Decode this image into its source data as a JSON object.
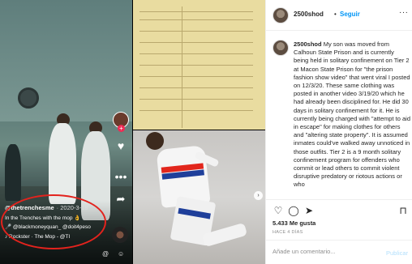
{
  "tiktok_overlay": {
    "username": "@thetrenchesme",
    "date": "· 2020-3-18",
    "line1": "In the Trenches with the mop 👌",
    "line2": "🎤 @blackmoneyquan_ @doit4peso",
    "line3": "♪ Rockster · The Mop - @TI",
    "icons": [
      "heart-icon",
      "more-dots-icon",
      "share-arrow-icon",
      "music-disc-icon"
    ],
    "annotation_color": "#e3231d"
  },
  "post": {
    "username": "2500shod",
    "separator": "•",
    "follow_label": "Seguir",
    "more_label": "···",
    "caption_username": "2500shod",
    "caption_text": "My son was moved from Calhoun State Prison and is currently being held in solitary confinement on Tier 2 at Macon State Prison for \"the prison fashion show video\" that went viral I posted on 12/3/20. These same clothing was posted in another video 3/19/20 which he had already been disciplined for. He did 30 days in solitary confinement for it. He is currently being charged with \"attempt to aid in escape\" for making clothes for others and \"altering state property\". It is assumed inmates could've walked away unnoticed in those outfits. Tier 2 is a 9 month solitary confinement program for offenders who commit or lead others to commit violent disruptive predatory or riotous actions or who",
    "likes": "5.433 Me gusta",
    "time_ago": "HACE 4 DÍAS",
    "comment_placeholder": "Añade un comentario...",
    "publish_label": "Publicar",
    "accent_color": "#0095f6"
  }
}
